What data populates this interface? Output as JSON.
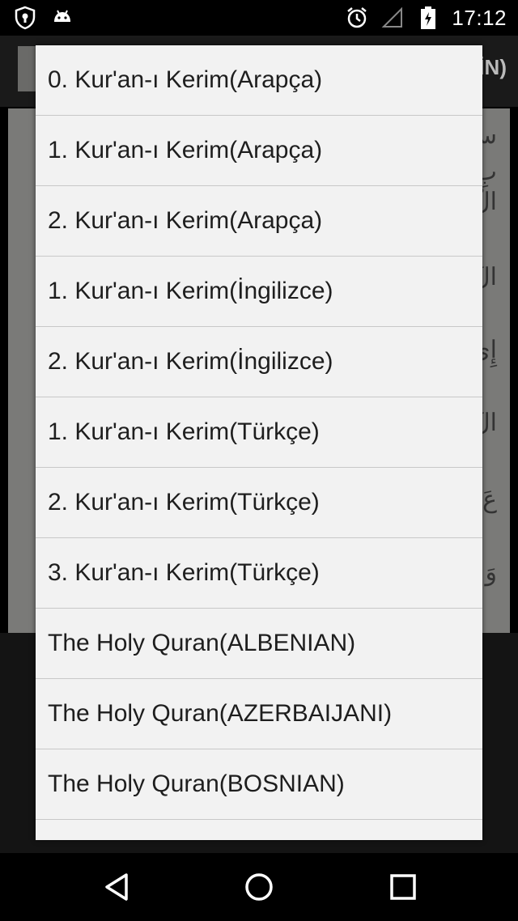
{
  "status_bar": {
    "time": "17:12",
    "icons_left": [
      "shield-icon",
      "android-icon"
    ],
    "icons_right": [
      "alarm-icon",
      "signal-icon",
      "battery-icon"
    ]
  },
  "background": {
    "title_tail": "İN)"
  },
  "dialog": {
    "items": [
      "0. Kur'an-ı Kerim(Arapça)",
      "1. Kur'an-ı Kerim(Arapça)",
      "2. Kur'an-ı Kerim(Arapça)",
      "1. Kur'an-ı Kerim(İngilizce)",
      "2. Kur'an-ı Kerim(İngilizce)",
      "1. Kur'an-ı Kerim(Türkçe)",
      "2. Kur'an-ı Kerim(Türkçe)",
      "3. Kur'an-ı Kerim(Türkçe)",
      "The Holy Quran(ALBENIAN)",
      "The Holy Quran(AZERBAIJANI)",
      "The Holy Quran(BOSNIAN)",
      ""
    ]
  },
  "nav_bar": {
    "buttons": [
      "back-icon",
      "home-icon",
      "recents-icon"
    ]
  }
}
